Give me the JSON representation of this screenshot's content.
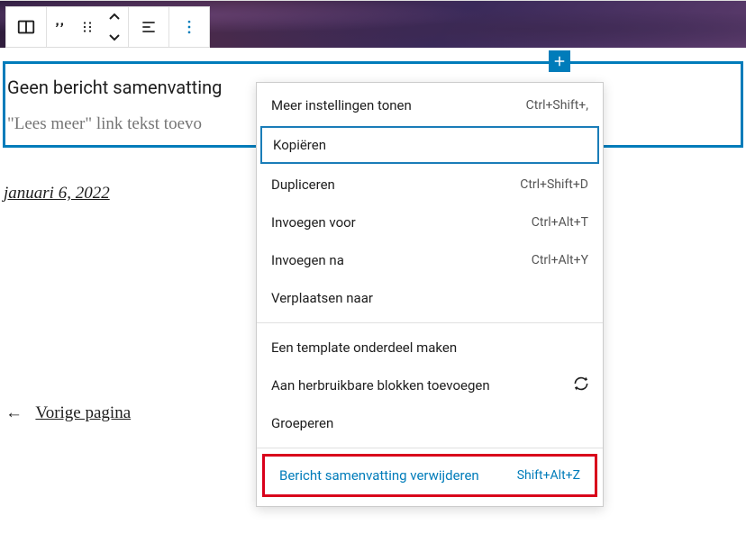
{
  "toolbar": {
    "block_icon": "columns",
    "quote_icon": "quote",
    "drag_icon": "drag-handle",
    "align_icon": "align-left",
    "options_icon": "more-vertical"
  },
  "insert_button_label": "+",
  "excerpt": {
    "summary_text": "Geen bericht samenvatting",
    "linktext_placeholder": "\"Lees meer\" link tekst toevo"
  },
  "post_date": "januari 6, 2022",
  "pagination": {
    "arrow": "←",
    "prev_label": "Vorige pagina"
  },
  "menu": {
    "section1": [
      {
        "label": "Meer instellingen tonen",
        "shortcut": "Ctrl+Shift+,"
      },
      {
        "label": "Kopiëren",
        "shortcut": "",
        "highlighted": true
      },
      {
        "label": "Dupliceren",
        "shortcut": "Ctrl+Shift+D"
      },
      {
        "label": "Invoegen voor",
        "shortcut": "Ctrl+Alt+T"
      },
      {
        "label": "Invoegen na",
        "shortcut": "Ctrl+Alt+Y"
      },
      {
        "label": "Verplaatsen naar",
        "shortcut": ""
      }
    ],
    "section2": [
      {
        "label": "Een template onderdeel maken",
        "shortcut": ""
      },
      {
        "label": "Aan herbruikbare blokken toevoegen",
        "shortcut": "",
        "has_refresh_icon": true
      },
      {
        "label": "Groeperen",
        "shortcut": ""
      }
    ],
    "section3": {
      "label": "Bericht samenvatting verwijderen",
      "shortcut": "Shift+Alt+Z"
    }
  }
}
